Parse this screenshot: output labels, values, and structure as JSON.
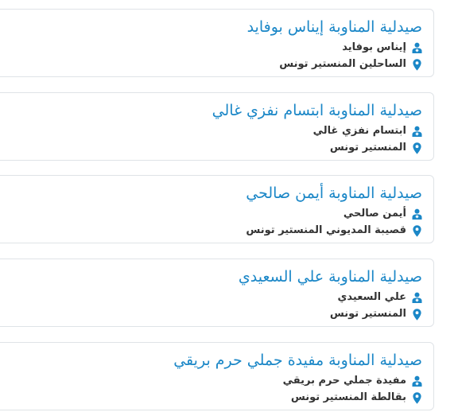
{
  "colors": {
    "title": "#1b87c7",
    "icon": "#1b87c7",
    "text": "#333333",
    "border": "#dfe3e7"
  },
  "icons": {
    "owner": "pharmacist-icon",
    "address": "location-pin-icon"
  },
  "pharmacies": [
    {
      "title": "صيدلية المناوبة إيناس بوفايد",
      "owner": "إيناس بوفايد",
      "address": "الساحلين المنستير تونس"
    },
    {
      "title": "صيدلية المناوبة ابتسام نفزي غالي",
      "owner": "ابتسام نفزي غالي",
      "address": "المنستير تونس"
    },
    {
      "title": "صيدلية المناوبة أيمن صالحي",
      "owner": "أيمن صالحي",
      "address": "قصيبة المديوني المنستير تونس"
    },
    {
      "title": "صيدلية المناوبة علي السعيدي",
      "owner": "علي السعيدي",
      "address": "المنستير تونس"
    },
    {
      "title": "صيدلية المناوبة مفيدة جملي حرم بريقي",
      "owner": "مفيدة جملي حرم بريقي",
      "address": "بقالطة المنستير تونس"
    }
  ]
}
